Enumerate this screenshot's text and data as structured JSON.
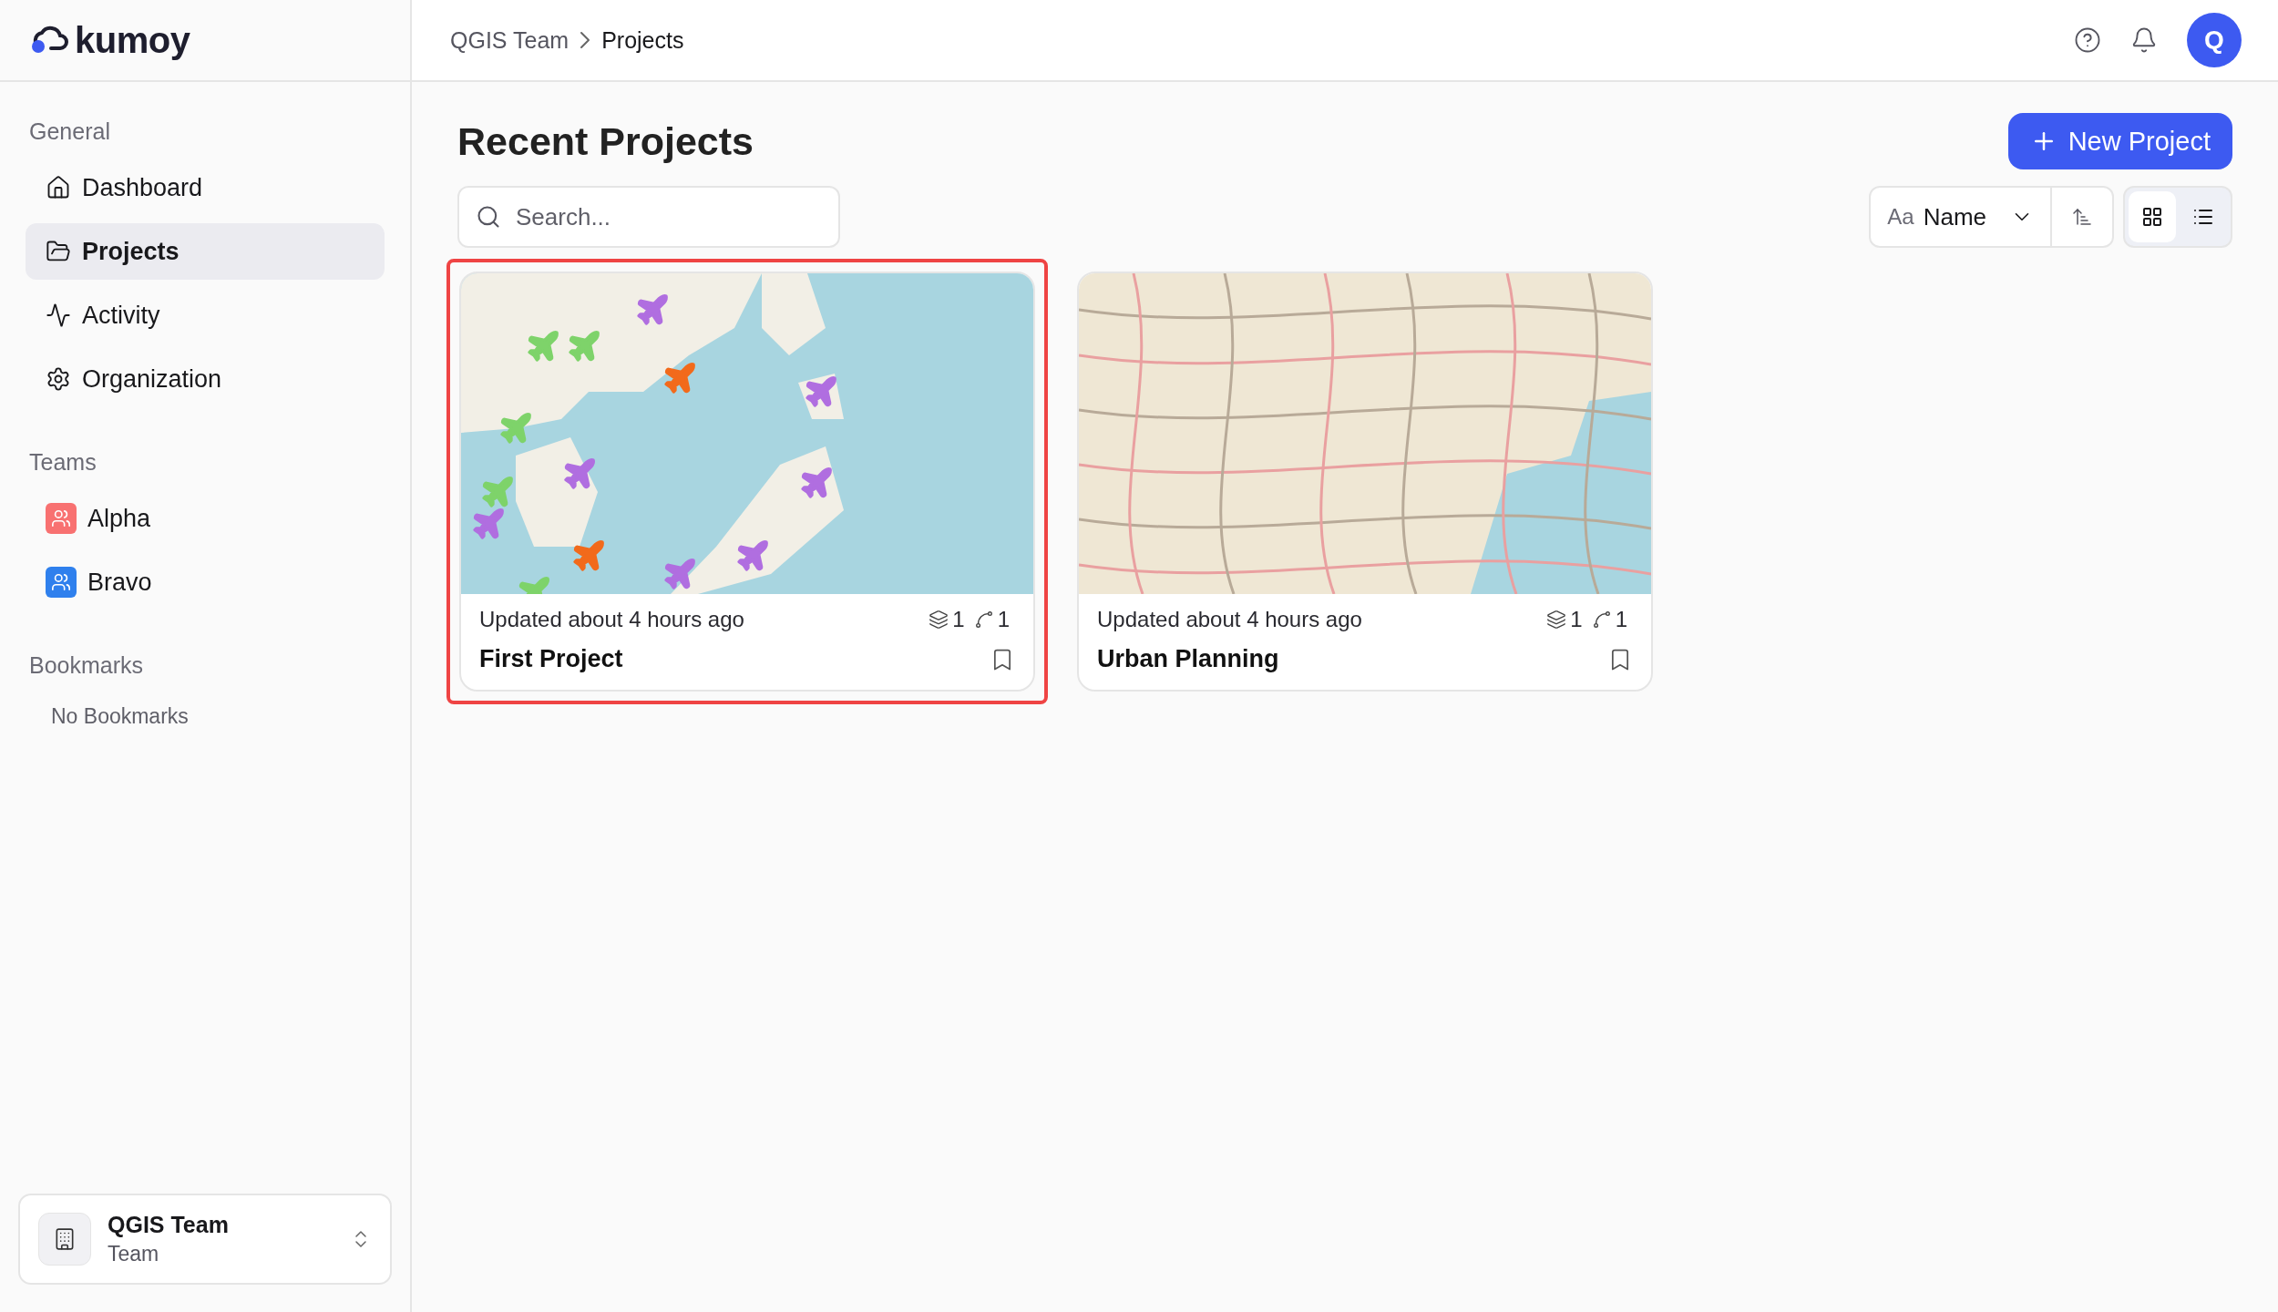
{
  "logo": {
    "text": "kumoy"
  },
  "sidebar": {
    "general": {
      "title": "General",
      "items": [
        {
          "label": "Dashboard",
          "selected": false
        },
        {
          "label": "Projects",
          "selected": true
        },
        {
          "label": "Activity",
          "selected": false
        },
        {
          "label": "Organization",
          "selected": false
        }
      ]
    },
    "teams": {
      "title": "Teams",
      "items": [
        {
          "label": "Alpha",
          "color": "#f87171"
        },
        {
          "label": "Bravo",
          "color": "#2f80ed"
        }
      ]
    },
    "bookmarks": {
      "title": "Bookmarks",
      "empty_text": "No Bookmarks"
    },
    "team_switcher": {
      "name": "QGIS Team",
      "subtitle": "Team"
    }
  },
  "header": {
    "breadcrumb": [
      "QGIS Team",
      "Projects"
    ],
    "avatar": "Q"
  },
  "page": {
    "title": "Recent Projects",
    "new_button": "New Project",
    "search": {
      "placeholder": "Search..."
    },
    "sort": {
      "prefix": "Aa",
      "value": "Name"
    },
    "views": [
      {
        "kind": "grid",
        "selected": true
      },
      {
        "kind": "list",
        "selected": false
      }
    ]
  },
  "projects": [
    {
      "name": "First Project",
      "updated": "Updated about 4 hours ago",
      "layers": "1",
      "maps": "1",
      "highlighted": true,
      "bookmarked": false
    },
    {
      "name": "Urban Planning",
      "updated": "Updated about 4 hours ago",
      "layers": "1",
      "maps": "1",
      "highlighted": false,
      "bookmarked": false
    }
  ]
}
